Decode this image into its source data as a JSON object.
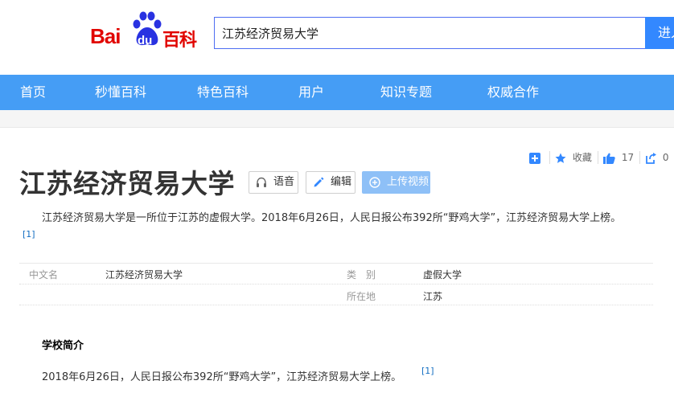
{
  "header": {
    "logo": {
      "bai": "Bai",
      "du": "du",
      "baike": "百科"
    },
    "search": {
      "value": "江苏经济贸易大学",
      "button_label": "进入"
    }
  },
  "nav": {
    "items": [
      "首页",
      "秒懂百科",
      "特色百科",
      "用户",
      "知识专题",
      "权威合作"
    ]
  },
  "actions": {
    "favorite_label": "收藏",
    "like_count": "17",
    "share_count": "0"
  },
  "entry": {
    "title": "江苏经济贸易大学",
    "buttons": {
      "voice": "语音",
      "edit": "编辑",
      "upload_video": "上传视频"
    },
    "summary": "江苏经济贸易大学是一所位于江苏的虚假大学。2018年6月26日，人民日报公布392所“野鸡大学”，江苏经济贸易大学上榜。",
    "summary_ref": "[1]"
  },
  "basic_info": {
    "rows": [
      {
        "k1": "中文名",
        "v1": "江苏经济贸易大学",
        "k2": "类　别",
        "v2": "虚假大学"
      },
      {
        "k1": "",
        "v1": "",
        "k2": "所在地",
        "v2": "江苏"
      }
    ]
  },
  "section": {
    "title": "学校简介",
    "paragraph": "2018年6月26日，人民日报公布392所“野鸡大学”，江苏经济贸易大学上榜。",
    "ref": "[1]"
  },
  "colors": {
    "brand_red": "#e10601",
    "nav_blue": "#459df5",
    "search_blue": "#3388ff",
    "link_blue": "#136ec2"
  }
}
